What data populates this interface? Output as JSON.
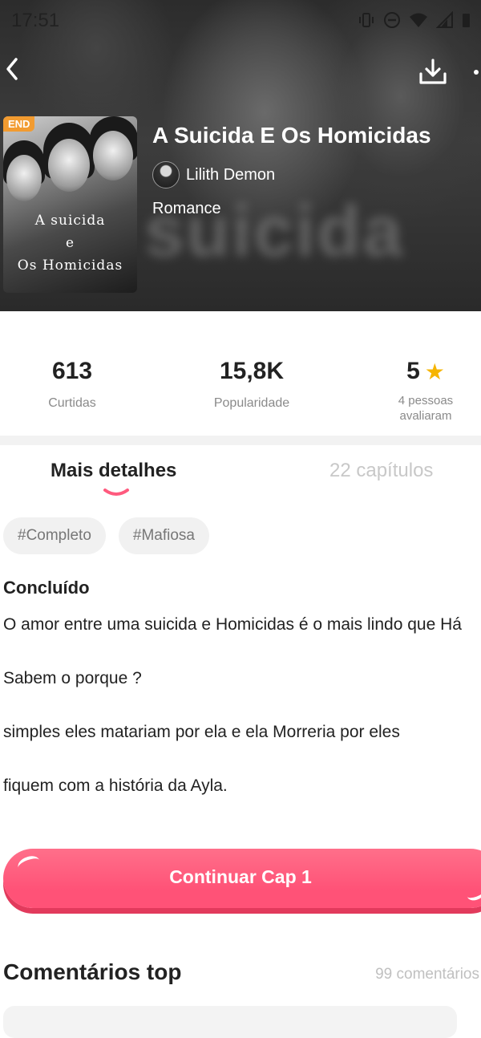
{
  "status_bar": {
    "time": "17:51"
  },
  "header": {
    "title": "A Suicida E Os Homicidas",
    "author": "Lilith Demon",
    "genre": "Romance",
    "badge": "END",
    "cover_text": [
      "A suicida",
      "e",
      "Os Homicidas"
    ],
    "background_word": "suicida"
  },
  "stats": {
    "likes": {
      "value": "613",
      "label": "Curtidas"
    },
    "popularity": {
      "value": "15,8K",
      "label": "Popularidade"
    },
    "rating": {
      "value": "5",
      "label_line1": "4 pessoas",
      "label_line2": "avaliaram"
    }
  },
  "tabs": [
    {
      "label": "Mais detalhes",
      "active": true
    },
    {
      "label": "22 capítulos",
      "active": false
    }
  ],
  "tags": [
    "#Completo",
    "#Mafiosa"
  ],
  "status": "Concluído",
  "description": [
    "O amor entre uma suicida e Homicidas é o mais lindo que Há",
    "Sabem o porque ?",
    "simples eles matariam por ela e ela Morreria por eles",
    "fiquem com a história da Ayla."
  ],
  "continue_button": "Continuar Cap 1",
  "comments": {
    "title": "Comentários top",
    "count": "99 comentários"
  },
  "colors": {
    "accent": "#ff5a7e",
    "star": "#f6b400",
    "badge": "#f29b30"
  }
}
